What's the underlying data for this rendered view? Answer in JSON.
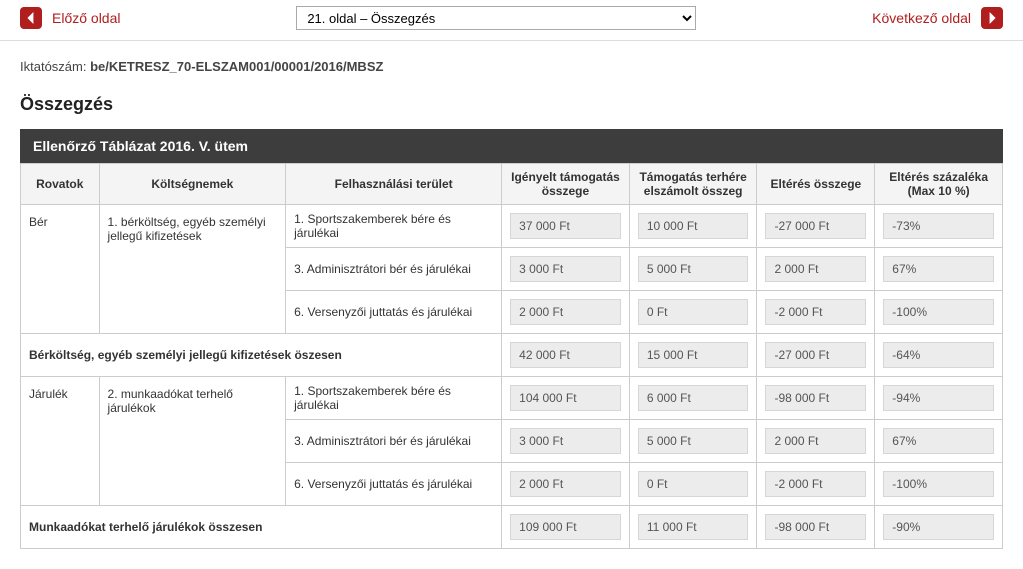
{
  "nav": {
    "prev_label": "Előző oldal",
    "next_label": "Következő oldal",
    "page_select_value": "21. oldal – Összegzés"
  },
  "meta": {
    "iktato_label": "Iktatószám:",
    "iktato_value": "be/KETRESZ_70-ELSZAM001/00001/2016/MBSZ"
  },
  "section_title": "Összegzés",
  "table_title": "Ellenőrző Táblázat 2016. V. ütem",
  "headers": {
    "rovatok": "Rovatok",
    "koltsegnemek": "Költségnemek",
    "felhasznalasi": "Felhasználási terület",
    "igenyelt": "Igényelt támogatás összege",
    "terhere": "Támogatás terhére elszámolt összeg",
    "elteres_osszeg": "Eltérés összege",
    "elteres_szazalek": "Eltérés százaléka (Max 10 %)"
  },
  "groups": [
    {
      "rovat": "Bér",
      "koltseg": "1. bérköltség, egyéb személyi jellegű kifizetések",
      "rows": [
        {
          "felh": "1. Sportszakemberek bére és járulékai",
          "a": "37 000 Ft",
          "b": "10 000 Ft",
          "c": "-27 000 Ft",
          "d": "-73%"
        },
        {
          "felh": "3. Adminisztrátori bér és járulékai",
          "a": "3 000 Ft",
          "b": "5 000 Ft",
          "c": "2 000 Ft",
          "d": "67%"
        },
        {
          "felh": "6. Versenyzői juttatás és járulékai",
          "a": "2 000 Ft",
          "b": "0 Ft",
          "c": "-2 000 Ft",
          "d": "-100%"
        }
      ],
      "subtotal": {
        "label": "Bérköltség, egyéb személyi jellegű kifizetések öszesen",
        "a": "42 000 Ft",
        "b": "15 000 Ft",
        "c": "-27 000 Ft",
        "d": "-64%"
      }
    },
    {
      "rovat": "Járulék",
      "koltseg": "2. munkaadókat terhelő járulékok",
      "rows": [
        {
          "felh": "1. Sportszakemberek bére és járulékai",
          "a": "104 000 Ft",
          "b": "6 000 Ft",
          "c": "-98 000 Ft",
          "d": "-94%"
        },
        {
          "felh": "3. Adminisztrátori bér és járulékai",
          "a": "3 000 Ft",
          "b": "5 000 Ft",
          "c": "2 000 Ft",
          "d": "67%"
        },
        {
          "felh": "6. Versenyzői juttatás és járulékai",
          "a": "2 000 Ft",
          "b": "0 Ft",
          "c": "-2 000 Ft",
          "d": "-100%"
        }
      ],
      "subtotal": {
        "label": "Munkaadókat terhelő járulékok összesen",
        "a": "109 000 Ft",
        "b": "11 000 Ft",
        "c": "-98 000 Ft",
        "d": "-90%"
      }
    }
  ]
}
